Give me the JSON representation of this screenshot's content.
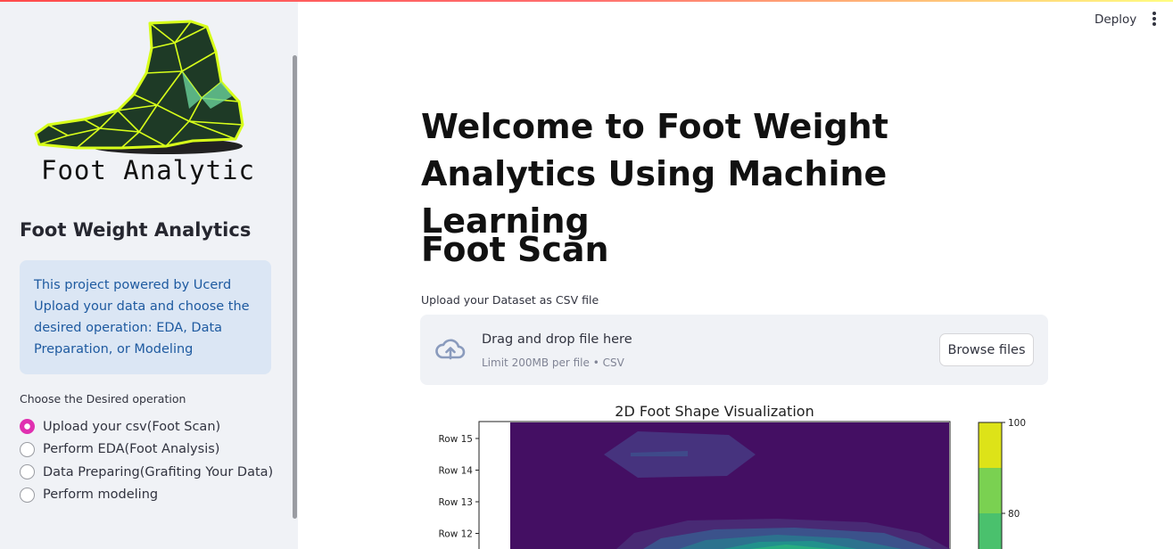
{
  "sidebar": {
    "logo_text": "Foot Analytic",
    "title": "Foot Weight Analytics",
    "info_text": "This project powered by Ucerd Upload your data and choose the desired operation: EDA, Data Preparation, or Modeling",
    "operation_label": "Choose the Desired operation",
    "options": [
      {
        "label": "Upload your csv(Foot Scan)",
        "checked": true
      },
      {
        "label": "Perform EDA(Foot Analysis)",
        "checked": false
      },
      {
        "label": "Data Preparing(Grafiting Your Data)",
        "checked": false
      },
      {
        "label": "Perform modeling",
        "checked": false
      }
    ]
  },
  "header": {
    "deploy_label": "Deploy"
  },
  "main": {
    "title": "Welcome to Foot Weight Analytics Using Machine Learning",
    "section_title": "Foot Scan",
    "upload_label": "Upload your Dataset as CSV file",
    "dropzone_title": "Drag and drop file here",
    "dropzone_sub": "Limit 200MB per file • CSV",
    "browse_label": "Browse files"
  },
  "icons": {
    "upload": "cloud-upload-icon",
    "menu": "kebab-menu-icon"
  },
  "colors": {
    "accent": "#ff4b4b",
    "radio_selected": "#e030b0",
    "info_bg": "#dbe6f4",
    "info_text": "#1e5aa0"
  },
  "chart_data": {
    "type": "heatmap",
    "title": "2D Foot Shape Visualization",
    "y_tick_labels": [
      "Row 15",
      "Row 14",
      "Row 13",
      "Row 12"
    ],
    "colorbar_ticks": [
      100,
      80
    ],
    "colorbar_levels": [
      {
        "from": 100,
        "to": 90,
        "color": "#dde318"
      },
      {
        "from": 90,
        "to": 80,
        "color": "#7ad151"
      },
      {
        "from": 80,
        "to": 70,
        "color": "#4ac16d"
      }
    ]
  }
}
